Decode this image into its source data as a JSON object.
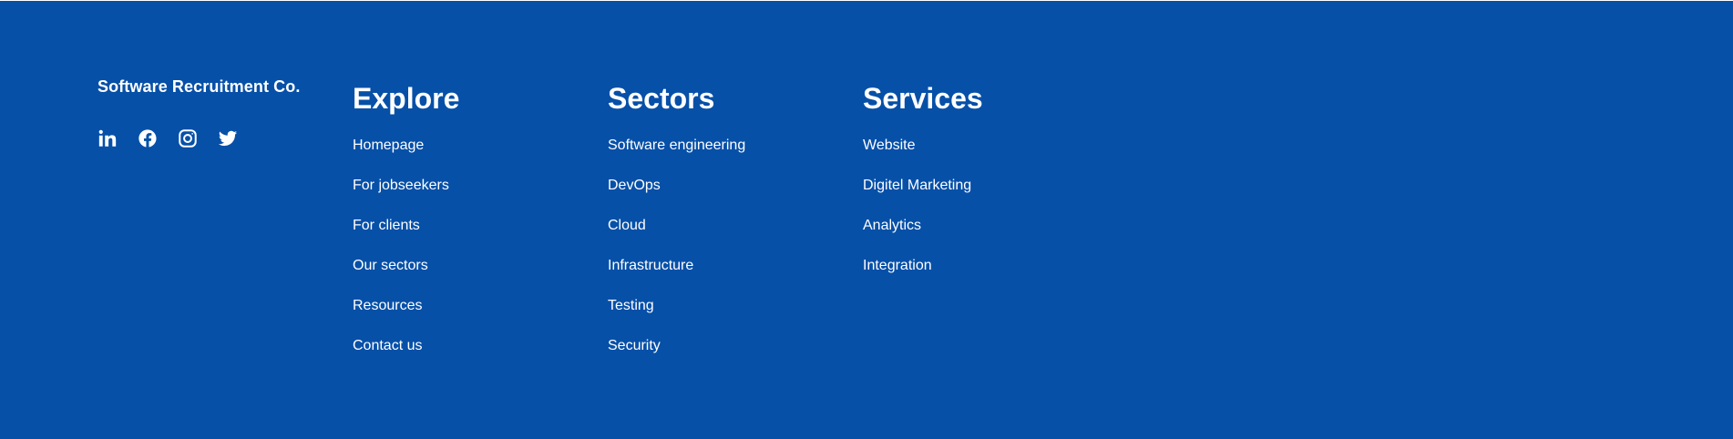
{
  "colors": {
    "footer_background": "#0650a8",
    "text": "#ffffff"
  },
  "brand": {
    "name": "Software Recruitment Co."
  },
  "social": [
    {
      "icon": "linkedin-icon"
    },
    {
      "icon": "facebook-icon"
    },
    {
      "icon": "instagram-icon"
    },
    {
      "icon": "twitter-icon"
    }
  ],
  "columns": {
    "explore": {
      "title": "Explore",
      "links": [
        "Homepage",
        "For jobseekers",
        "For clients",
        "Our sectors",
        "Resources",
        "Contact us"
      ]
    },
    "sectors": {
      "title": "Sectors",
      "links": [
        "Software engineering",
        "DevOps",
        "Cloud",
        "Infrastructure",
        "Testing",
        "Security"
      ]
    },
    "services": {
      "title": "Services",
      "links": [
        "Website",
        "Digitel Marketing",
        "Analytics",
        "Integration"
      ]
    }
  }
}
